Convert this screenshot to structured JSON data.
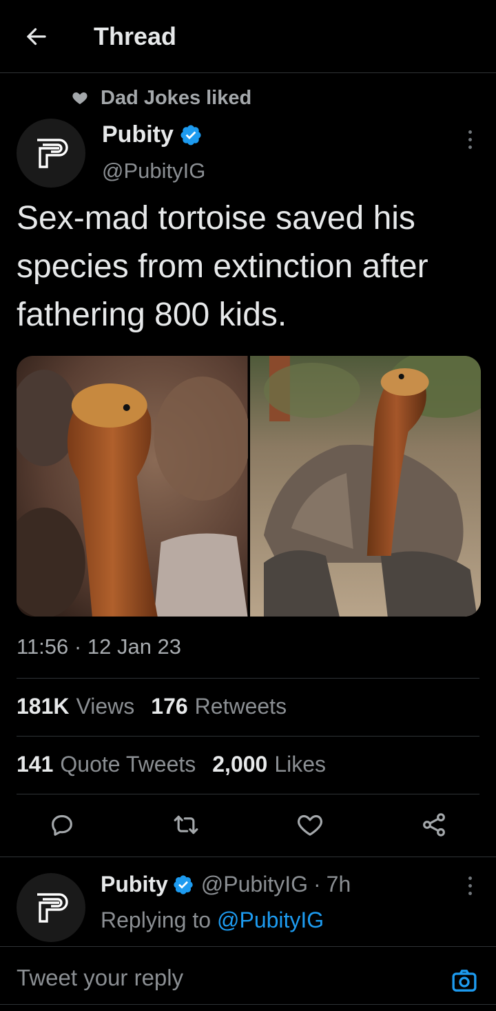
{
  "header": {
    "title": "Thread",
    "back_icon": "arrow-left-icon"
  },
  "social_context": {
    "text": "Dad Jokes liked",
    "icon": "heart-icon"
  },
  "tweet": {
    "author_name": "Pubity",
    "author_handle": "@PubityIG",
    "verified": true,
    "text": "Sex-mad tortoise saved his species from extinction after fathering 800 kids.",
    "media": [
      {
        "subject": "tortoise close-up",
        "icon": "photo"
      },
      {
        "subject": "tortoise full body",
        "icon": "photo"
      }
    ],
    "time": "11:56",
    "date": "12 Jan 23",
    "time_separator": "·"
  },
  "stats": {
    "views_count": "181K",
    "views_label": "Views",
    "retweets_count": "176",
    "retweets_label": "Retweets",
    "quotes_count": "141",
    "quotes_label": "Quote Tweets",
    "likes_count": "2,000",
    "likes_label": "Likes"
  },
  "actions": [
    {
      "name": "reply",
      "icon": "reply-icon"
    },
    {
      "name": "retweet",
      "icon": "retweet-icon"
    },
    {
      "name": "like",
      "icon": "heart-outline-icon"
    },
    {
      "name": "share",
      "icon": "share-icon"
    }
  ],
  "reply": {
    "author_name": "Pubity",
    "author_handle": "@PubityIG",
    "separator": "·",
    "time_ago": "7h",
    "replying_to_label": "Replying to",
    "replying_to_handle": "@PubityIG"
  },
  "composer": {
    "placeholder": "Tweet your reply",
    "camera_icon": "camera-icon"
  },
  "colors": {
    "background": "#000000",
    "text": "#e7e9ea",
    "secondary": "#8b8f93",
    "accent": "#1d9bf0",
    "divider": "#2f3336"
  }
}
